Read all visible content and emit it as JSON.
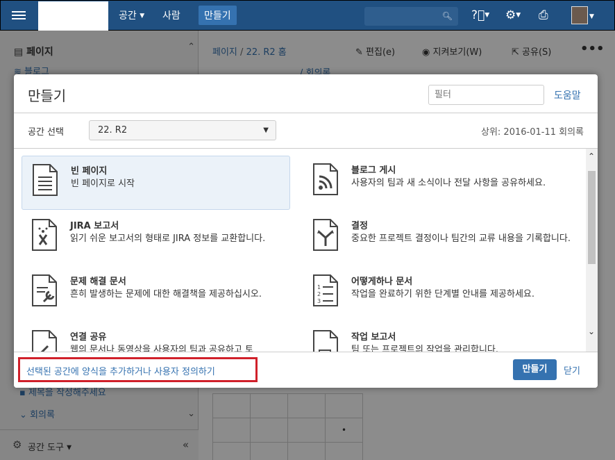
{
  "topnav": {
    "spaces": "공간",
    "people": "사람",
    "create": "만들기",
    "search_icon": "search-icon",
    "help_icon": "help-icon",
    "settings_icon": "gear-icon",
    "inbox_icon": "inbox-icon"
  },
  "sidebar": {
    "pages": "페이지",
    "blog": "블로그",
    "item_title": "제목을 작성해주세요",
    "item_minutes": "회의록",
    "space_tools": "공간 도구"
  },
  "page": {
    "breadcrumb_space": "페이지",
    "breadcrumb_sep": "/",
    "breadcrumb_home": "22. R2 홈",
    "edit": "편집(e)",
    "watch": "지켜보기(W)",
    "share": "공유(S)",
    "more": "•••",
    "minutes_crumb": "/ 회의록"
  },
  "dialog": {
    "title": "만들기",
    "filter_placeholder": "필터",
    "help": "도움말",
    "space_label": "공간 선택",
    "space_value": "22. R2",
    "parent": "상위: 2016-01-11 회의록",
    "templates": [
      {
        "name": "빈 페이지",
        "desc": "빈 페이지로 시작",
        "icon": "blank-page-icon"
      },
      {
        "name": "블로그 게시",
        "desc": "사용자의 팀과 새 소식이나 전달 사항을 공유하세요.",
        "icon": "blog-icon"
      },
      {
        "name": "JIRA 보고서",
        "desc": "읽기 쉬운 보고서의 형태로 JIRA 정보를 교환합니다.",
        "icon": "jira-report-icon"
      },
      {
        "name": "결정",
        "desc": "중요한 프로젝트 결정이나 팀간의 교류 내용을 기록합니다.",
        "icon": "decision-icon"
      },
      {
        "name": "문제 해결 문서",
        "desc": "흔히 발생하는 문제에 대한 해결책을 제공하십시오.",
        "icon": "troubleshooting-icon"
      },
      {
        "name": "어떻게하나 문서",
        "desc": "작업을 완료하기 위한 단계별 안내를 제공하세요.",
        "icon": "how-to-icon"
      },
      {
        "name": "연결 공유",
        "desc": "웹의 문서나 동영상을 사용자의 팀과 공유하고 토",
        "icon": "share-link-icon"
      },
      {
        "name": "작업 보고서",
        "desc": "팀 또는 프로젝트의 작업을 관리합니다.",
        "icon": "task-report-icon"
      }
    ],
    "customize": "선택된 공간에 양식을 추가하거나 사용자 정의하기",
    "create_button": "만들기",
    "close": "닫기"
  },
  "colors": {
    "nav_bg": "#205081",
    "accent": "#3572b0",
    "highlight_border": "#d0202a"
  }
}
